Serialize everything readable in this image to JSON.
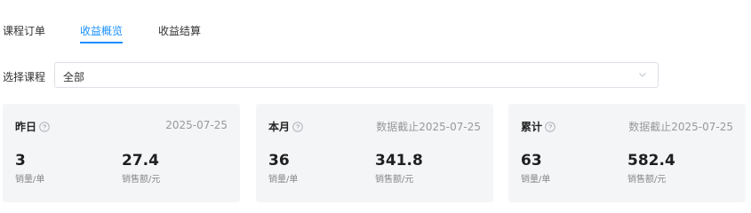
{
  "tabs": [
    "课程订单",
    "收益概览",
    "收益结算"
  ],
  "filter": {
    "label": "选择课程",
    "value": "全部"
  },
  "cards": [
    {
      "title": "昨日",
      "date": "2025-07-25",
      "count": "3",
      "count_unit": "销量/单",
      "amount": "27.4",
      "amount_unit": "销售额/元"
    },
    {
      "title": "本月",
      "date": "数据截止2025-07-25",
      "count": "36",
      "count_unit": "销量/单",
      "amount": "341.8",
      "amount_unit": "销售额/元"
    },
    {
      "title": "累计",
      "date": "数据截止2025-07-25",
      "count": "63",
      "count_unit": "销量/单",
      "amount": "582.4",
      "amount_unit": "销售额/元"
    }
  ],
  "colors": {
    "accent": "#1890ff",
    "card_bg": "#f4f5f7",
    "muted_text": "#999999"
  },
  "icons": {
    "help": "question-circle-icon",
    "dropdown": "chevron-down-icon"
  }
}
